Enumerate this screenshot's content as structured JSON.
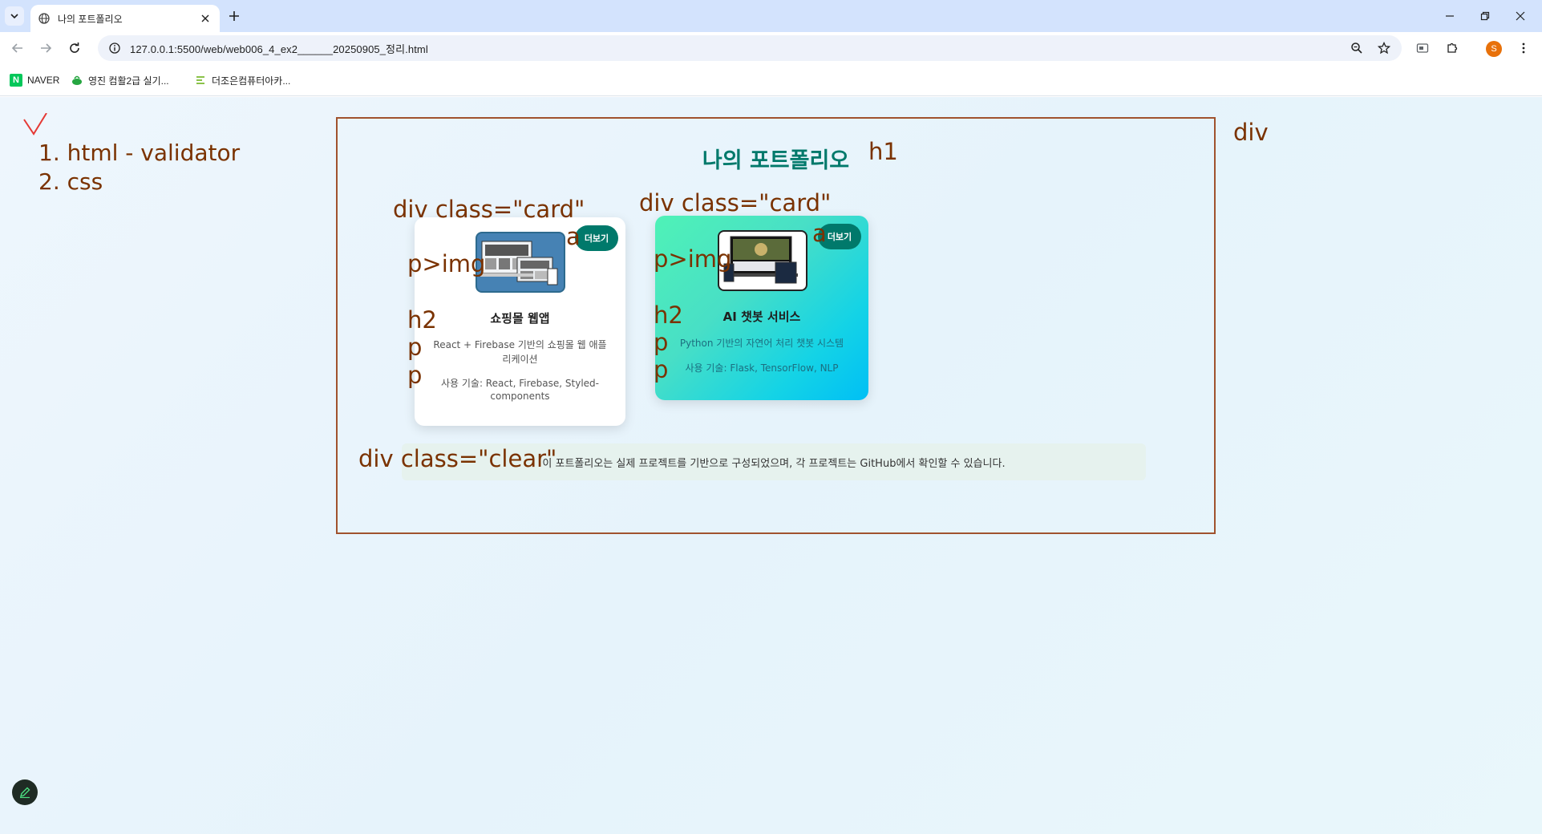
{
  "browser": {
    "tab_title": "나의 포트폴리오",
    "url": "127.0.0.1:5500/web/web006_4_ex2______20250905_정리.html",
    "bookmarks": [
      {
        "label": "NAVER",
        "icon": "naver-icon"
      },
      {
        "label": "영진 컴활2급 실기...",
        "icon": "cup-icon"
      },
      {
        "label": "더조은컴퓨터아카...",
        "icon": "academy-icon"
      }
    ],
    "profile_initial": "S"
  },
  "page": {
    "title": "나의 포트폴리오",
    "cards": [
      {
        "more_label": "더보기",
        "title": "쇼핑몰 웹앱",
        "description": "React + Firebase 기반의 쇼핑몰 웹 애플리케이션",
        "tech": "사용 기술: React, Firebase, Styled-components"
      },
      {
        "more_label": "더보기",
        "title": "AI 챗봇 서비스",
        "description": "Python 기반의 자연어 처리 챗봇 시스템",
        "tech": "사용 기술: Flask, TensorFlow, NLP"
      }
    ],
    "clear_text": "이 포트폴리오는 실제 프로젝트를 기반으로 구성되었으며, 각 프로젝트는 GitHub에서 확인할 수 있습니다."
  },
  "annotations": {
    "list_1": "1. html - validator",
    "list_2": "2. css",
    "div_outer": "div",
    "h1": "h1",
    "card1_div": "div  class=\"card\"",
    "card2_div": "div  class=\"card\"",
    "card1_a": "a",
    "card2_a": "a",
    "card1_pimg": "p>img",
    "card2_pimg": "p>img",
    "card1_h2": "h2",
    "card2_h2": "h2",
    "card1_p1": "p",
    "card1_p2": "p",
    "card2_p1": "p",
    "card2_p2": "p",
    "clear_div": "div class=\"clear\""
  },
  "colors": {
    "accent": "#00796b",
    "annotation": "#7a3200",
    "container_border": "#a0522d"
  }
}
